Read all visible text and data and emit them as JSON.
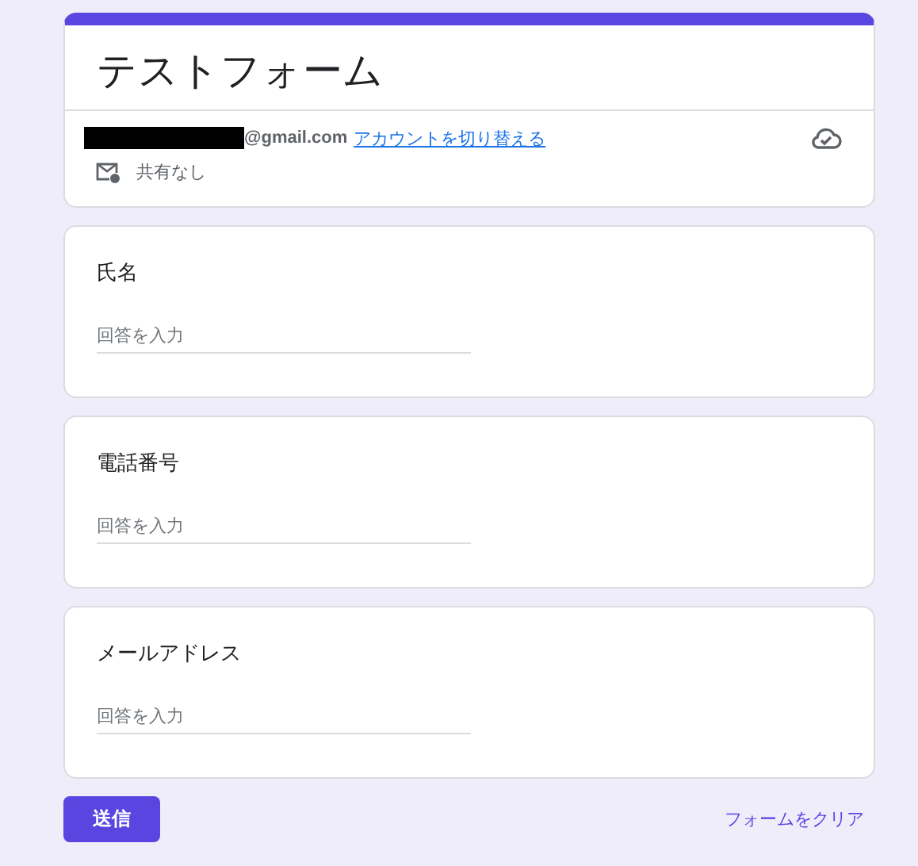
{
  "form": {
    "title": "テストフォーム"
  },
  "account": {
    "email": "@gmail.com",
    "switch_link": "アカウントを切り替える",
    "sharing": "共有なし"
  },
  "questions": [
    {
      "label": "氏名",
      "placeholder": "回答を入力"
    },
    {
      "label": "電話番号",
      "placeholder": "回答を入力"
    },
    {
      "label": "メールアドレス",
      "placeholder": "回答を入力"
    }
  ],
  "submit_button": "送信",
  "clear_link": "フォームをクリア"
}
